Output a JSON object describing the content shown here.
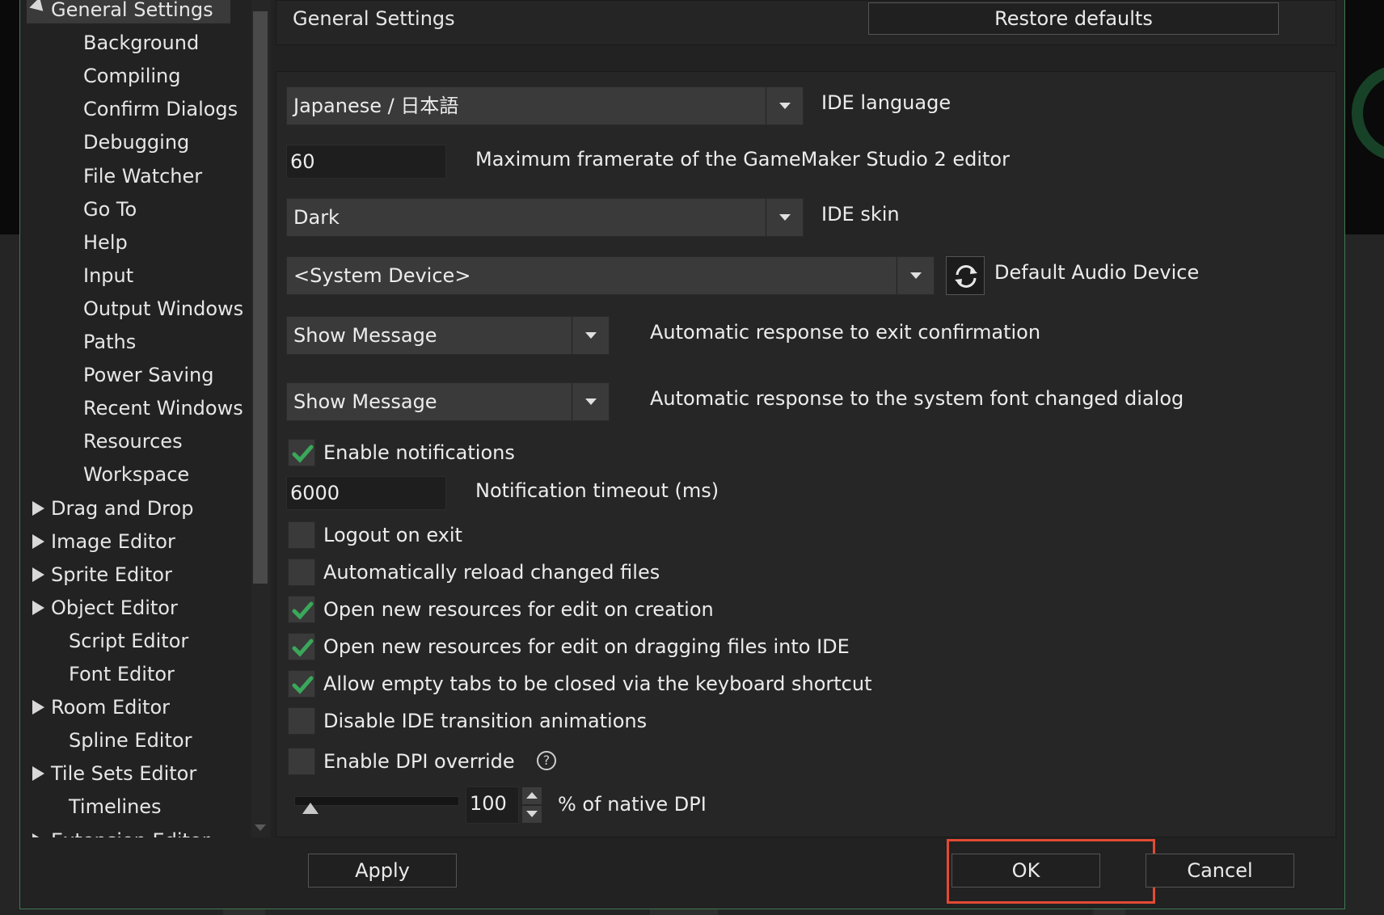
{
  "colors": {
    "accent_green": "#3aa85a",
    "highlight": "#e34a33",
    "panel": "#262626"
  },
  "sidebar": {
    "items": [
      {
        "label": "General Settings",
        "level": 0,
        "arrow": "down",
        "selected": true
      },
      {
        "label": "Background",
        "level": 2
      },
      {
        "label": "Compiling",
        "level": 2
      },
      {
        "label": "Confirm Dialogs",
        "level": 2
      },
      {
        "label": "Debugging",
        "level": 2
      },
      {
        "label": "File Watcher",
        "level": 2
      },
      {
        "label": "Go To",
        "level": 2
      },
      {
        "label": "Help",
        "level": 2
      },
      {
        "label": "Input",
        "level": 2
      },
      {
        "label": "Output Windows",
        "level": 2
      },
      {
        "label": "Paths",
        "level": 2
      },
      {
        "label": "Power Saving",
        "level": 2
      },
      {
        "label": "Recent Windows",
        "level": 2
      },
      {
        "label": "Resources",
        "level": 2
      },
      {
        "label": "Workspace",
        "level": 2
      },
      {
        "label": "Drag and Drop",
        "level": 0,
        "arrow": "right"
      },
      {
        "label": "Image Editor",
        "level": 0,
        "arrow": "right"
      },
      {
        "label": "Sprite Editor",
        "level": 0,
        "arrow": "right"
      },
      {
        "label": "Object Editor",
        "level": 0,
        "arrow": "right"
      },
      {
        "label": "Script Editor",
        "level": 1
      },
      {
        "label": "Font Editor",
        "level": 1
      },
      {
        "label": "Room Editor",
        "level": 0,
        "arrow": "right"
      },
      {
        "label": "Spline Editor",
        "level": 1
      },
      {
        "label": "Tile Sets Editor",
        "level": 0,
        "arrow": "right"
      },
      {
        "label": "Timelines",
        "level": 1
      },
      {
        "label": "Extension Editor",
        "level": 0,
        "arrow": "right"
      }
    ],
    "collapse_label": "«"
  },
  "header": {
    "title": "General Settings",
    "restore_label": "Restore defaults"
  },
  "settings": {
    "ide_language": {
      "value": "Japanese / 日本語",
      "label": "IDE language"
    },
    "framerate": {
      "value": "60",
      "label": "Maximum framerate of the GameMaker Studio 2 editor"
    },
    "ide_skin": {
      "value": "Dark",
      "label": "IDE skin"
    },
    "audio_device": {
      "value": "<System Device>",
      "label": "Default Audio Device"
    },
    "exit_response": {
      "value": "Show Message",
      "label": "Automatic response to exit confirmation"
    },
    "font_response": {
      "value": "Show Message",
      "label": "Automatic response to the system font changed dialog"
    },
    "checkboxes": [
      {
        "label": "Enable notifications",
        "checked": true
      },
      {
        "label": "Logout on exit",
        "checked": false
      },
      {
        "label": "Automatically reload changed files",
        "checked": false
      },
      {
        "label": "Open new resources for edit on creation",
        "checked": true
      },
      {
        "label": "Open new resources for edit on dragging files into IDE",
        "checked": true
      },
      {
        "label": "Allow empty tabs to be closed via the keyboard shortcut",
        "checked": true
      },
      {
        "label": "Disable IDE transition animations",
        "checked": false
      },
      {
        "label": "Enable DPI override",
        "checked": false
      }
    ],
    "notification_timeout": {
      "value": "6000",
      "label": "Notification timeout (ms)"
    },
    "dpi": {
      "value": "100",
      "label": "% of native DPI",
      "slider_fraction": 0.05
    },
    "help_glyph": "?"
  },
  "footer": {
    "apply_label": "Apply",
    "ok_label": "OK",
    "cancel_label": "Cancel"
  }
}
